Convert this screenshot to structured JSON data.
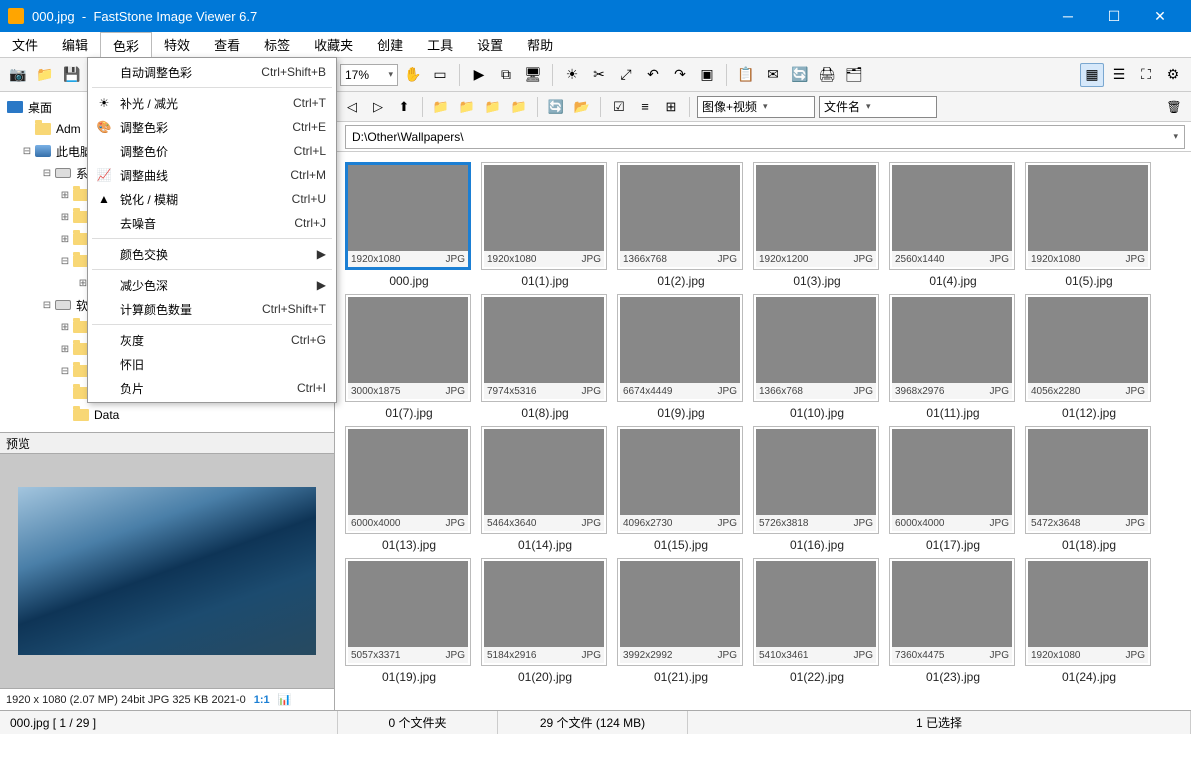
{
  "title": {
    "filename": "000.jpg",
    "app": "FastStone Image Viewer 6.7"
  },
  "menubar": [
    "文件",
    "编辑",
    "色彩",
    "特效",
    "查看",
    "标签",
    "收藏夹",
    "创建",
    "工具",
    "设置",
    "帮助"
  ],
  "menu_open_index": 2,
  "dropdown": {
    "groups": [
      [
        {
          "label": "自动调整色彩",
          "shortcut": "Ctrl+Shift+B",
          "icon": "auto"
        }
      ],
      [
        {
          "label": "补光 / 减光",
          "shortcut": "Ctrl+T",
          "icon": "sun"
        },
        {
          "label": "调整色彩",
          "shortcut": "Ctrl+E",
          "icon": "palette"
        },
        {
          "label": "调整色价",
          "shortcut": "Ctrl+L",
          "icon": ""
        },
        {
          "label": "调整曲线",
          "shortcut": "Ctrl+M",
          "icon": "curves"
        },
        {
          "label": "锐化 / 模糊",
          "shortcut": "Ctrl+U",
          "icon": "sharpen"
        },
        {
          "label": "去噪音",
          "shortcut": "Ctrl+J",
          "icon": ""
        }
      ],
      [
        {
          "label": "颜色交换",
          "shortcut": "",
          "submenu": true
        }
      ],
      [
        {
          "label": "减少色深",
          "shortcut": "",
          "submenu": true
        },
        {
          "label": "计算颜色数量",
          "shortcut": "Ctrl+Shift+T"
        }
      ],
      [
        {
          "label": "灰度",
          "shortcut": "Ctrl+G"
        },
        {
          "label": "怀旧",
          "shortcut": ""
        },
        {
          "label": "负片",
          "shortcut": "Ctrl+I"
        }
      ]
    ]
  },
  "toolbar": {
    "zoom": "17%"
  },
  "tree": {
    "root": "桌面",
    "nodes": [
      {
        "label": "Adm",
        "depth": 1,
        "icon": "folder",
        "twist": ""
      },
      {
        "label": "此电脑",
        "depth": 1,
        "icon": "pc",
        "twist": "-"
      },
      {
        "label": "系",
        "depth": 2,
        "icon": "drive",
        "twist": "-",
        "clipped": true
      },
      {
        "label": "",
        "depth": 3,
        "icon": "folder",
        "twist": "+"
      },
      {
        "label": "",
        "depth": 3,
        "icon": "folder",
        "twist": "+"
      },
      {
        "label": "",
        "depth": 3,
        "icon": "folder",
        "twist": "+"
      },
      {
        "label": "",
        "depth": 3,
        "icon": "folder",
        "twist": "-"
      },
      {
        "label": "",
        "depth": 4,
        "icon": "folder",
        "twist": "+"
      },
      {
        "label": "软",
        "depth": 2,
        "icon": "drive",
        "twist": "-",
        "clipped": true
      },
      {
        "label": "",
        "depth": 3,
        "icon": "folder",
        "twist": "+"
      },
      {
        "label": "",
        "depth": 3,
        "icon": "folder",
        "twist": "+"
      },
      {
        "label": "",
        "depth": 3,
        "icon": "folder",
        "twist": "-"
      },
      {
        "label": "",
        "depth": 3,
        "icon": "folder",
        "twist": ""
      },
      {
        "label": "Data",
        "depth": 3,
        "icon": "folder",
        "twist": ""
      }
    ]
  },
  "preview": {
    "header": "预览",
    "info": "1920 x 1080 (2.07 MP)   24bit   JPG   325 KB   2021-0",
    "ratio": "1:1"
  },
  "addrbar": {
    "filter": "图像+视频",
    "sort": "文件名"
  },
  "path": "D:\\Other\\Wallpapers\\",
  "thumbs": [
    {
      "name": "000.jpg",
      "dim": "1920x1080",
      "fmt": "JPG",
      "img": 1,
      "sel": true
    },
    {
      "name": "01(1).jpg",
      "dim": "1920x1080",
      "fmt": "JPG",
      "img": 2
    },
    {
      "name": "01(2).jpg",
      "dim": "1366x768",
      "fmt": "JPG",
      "img": 3
    },
    {
      "name": "01(3).jpg",
      "dim": "1920x1200",
      "fmt": "JPG",
      "img": 4
    },
    {
      "name": "01(4).jpg",
      "dim": "2560x1440",
      "fmt": "JPG",
      "img": 5
    },
    {
      "name": "01(5).jpg",
      "dim": "1920x1080",
      "fmt": "JPG",
      "img": 6
    },
    {
      "name": "01(7).jpg",
      "dim": "3000x1875",
      "fmt": "JPG",
      "img": 7
    },
    {
      "name": "01(8).jpg",
      "dim": "7974x5316",
      "fmt": "JPG",
      "img": 8
    },
    {
      "name": "01(9).jpg",
      "dim": "6674x4449",
      "fmt": "JPG",
      "img": 9
    },
    {
      "name": "01(10).jpg",
      "dim": "1366x768",
      "fmt": "JPG",
      "img": 10
    },
    {
      "name": "01(11).jpg",
      "dim": "3968x2976",
      "fmt": "JPG",
      "img": 11
    },
    {
      "name": "01(12).jpg",
      "dim": "4056x2280",
      "fmt": "JPG",
      "img": 12
    },
    {
      "name": "01(13).jpg",
      "dim": "6000x4000",
      "fmt": "JPG",
      "img": 13
    },
    {
      "name": "01(14).jpg",
      "dim": "5464x3640",
      "fmt": "JPG",
      "img": 14
    },
    {
      "name": "01(15).jpg",
      "dim": "4096x2730",
      "fmt": "JPG",
      "img": 15
    },
    {
      "name": "01(16).jpg",
      "dim": "5726x3818",
      "fmt": "JPG",
      "img": 16
    },
    {
      "name": "01(17).jpg",
      "dim": "6000x4000",
      "fmt": "JPG",
      "img": 17
    },
    {
      "name": "01(18).jpg",
      "dim": "5472x3648",
      "fmt": "JPG",
      "img": 18
    },
    {
      "name": "01(19).jpg",
      "dim": "5057x3371",
      "fmt": "JPG",
      "img": 19
    },
    {
      "name": "01(20).jpg",
      "dim": "5184x2916",
      "fmt": "JPG",
      "img": 20
    },
    {
      "name": "01(21).jpg",
      "dim": "3992x2992",
      "fmt": "JPG",
      "img": 21
    },
    {
      "name": "01(22).jpg",
      "dim": "5410x3461",
      "fmt": "JPG",
      "img": 22
    },
    {
      "name": "01(23).jpg",
      "dim": "7360x4475",
      "fmt": "JPG",
      "img": 23
    },
    {
      "name": "01(24).jpg",
      "dim": "1920x1080",
      "fmt": "JPG",
      "img": 24
    }
  ],
  "status": {
    "file": "000.jpg [ 1 / 29 ]",
    "folders": "0 个文件夹",
    "files": "29 个文件 (124 MB)",
    "selected": "1 已选择"
  }
}
